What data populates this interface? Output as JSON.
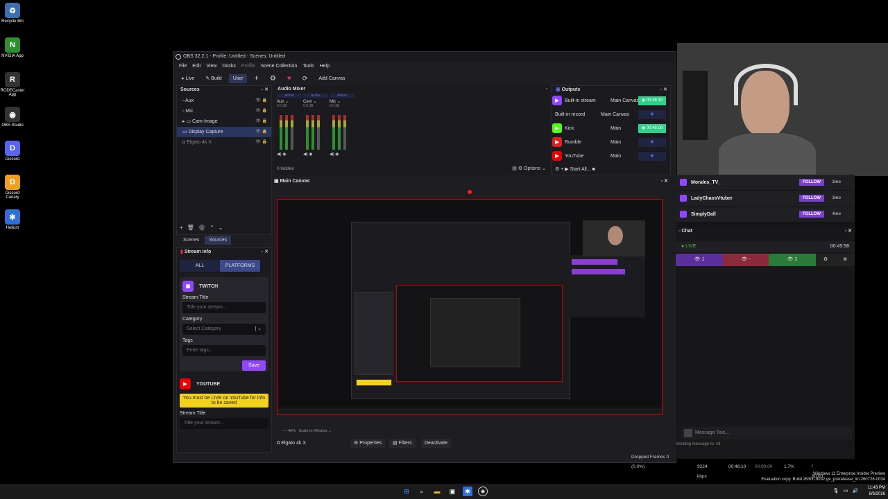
{
  "desktop": {
    "icons": [
      {
        "label": "Recycle Bin",
        "glyph": "♻",
        "color": "#3a6fb0"
      },
      {
        "label": "NVIDIA App",
        "glyph": "N",
        "color": "#2f8f2f"
      },
      {
        "label": "RODECaster App",
        "glyph": "R",
        "color": "#333"
      },
      {
        "label": "OBS Studio",
        "glyph": "◉",
        "color": "#333"
      },
      {
        "label": "Discord",
        "glyph": "D",
        "color": "#5865f2"
      },
      {
        "label": "Discord Canary",
        "glyph": "D",
        "color": "#f0a020"
      },
      {
        "label": "Helium",
        "glyph": "✱",
        "color": "#2f6fd8"
      }
    ],
    "watermark_line1": "Windows 11 Enterprise Insider Preview",
    "watermark_line2": "Evaluation copy. Build 26300.9032.ge_prerelease_im.260726-0034"
  },
  "obs": {
    "title": "OBS 32.2.1 - Profile: Untitled - Scenes: Untitled",
    "menu": [
      "File",
      "Edit",
      "View",
      "Docks",
      "Profile",
      "Scene Collection",
      "Tools",
      "Help"
    ],
    "toolbar": {
      "live": "Live",
      "build": "Build",
      "user": "User",
      "add_canvas": "Add Canvas"
    },
    "sources": {
      "title": "Sources",
      "items": [
        "Aux",
        "Mic",
        "Cam-Image",
        "Display Capture",
        "Elgato 4k X"
      ],
      "tab_scenes": "Scenes",
      "tab_sources": "Sources"
    },
    "audio_mixer": {
      "title": "Audio Mixer",
      "channels": [
        {
          "name": "Aux",
          "status": "Active",
          "db": "0.0 dB"
        },
        {
          "name": "Cam",
          "status": "Active",
          "db": "0.0 dB"
        },
        {
          "name": "Mic",
          "status": "Active",
          "db": "0.0 dB"
        }
      ],
      "hidden": "0 hidden",
      "options": "Options"
    },
    "outputs": {
      "title": "Outputs",
      "rows": [
        {
          "name": "Built-in stream",
          "canvas": "Main Canvas",
          "time": "00:46:10",
          "color": "#9146ff"
        },
        {
          "name": "Built-in record",
          "canvas": "Main Canvas",
          "time": "",
          "color": ""
        },
        {
          "name": "Kick",
          "canvas": "Main",
          "time": "00:46:09",
          "color": "#53fc18"
        },
        {
          "name": "Rumble",
          "canvas": "Main",
          "time": "",
          "color": "#d22"
        },
        {
          "name": "YouTube",
          "canvas": "Main",
          "time": "",
          "color": "#e00"
        }
      ],
      "start_all": "Start All..."
    },
    "main_canvas": {
      "title": "Main Canvas",
      "zoom": "40%",
      "scale": "Scale to Window"
    },
    "stream_info": {
      "title": "Stream Info",
      "btn_all": "ALL",
      "btn_platforms": "PLATFORMS",
      "twitch": "TWITCH",
      "stream_title_label": "Stream Title",
      "stream_title_placeholder": "Title your stream...",
      "category_label": "Category",
      "category_placeholder": "Select Category",
      "tags_label": "Tags",
      "tags_placeholder": "Enter tags...",
      "save": "Save",
      "youtube": "YOUTUBE",
      "youtube_warning": "You must be LIVE on YouTube for info to be saved",
      "youtube_stream_title": "Stream Title",
      "youtube_title_placeholder": "Title your stream..."
    },
    "source_bar": {
      "source": "Elgato 4k X",
      "properties": "Properties",
      "filters": "Filters",
      "deactivate": "Deactivate"
    },
    "status": {
      "dropped": "Dropped Frames 0 (0.0%)",
      "kbps": "9224 kbps",
      "stream_time": "00:46:10",
      "rec_time": "00:00:00",
      "cpu": "CPU: 1.7%",
      "fps": "60.00 / 60.00 FPS"
    }
  },
  "chat": {
    "followers": [
      {
        "name": "Morales_TV_",
        "follow": "FOLLOW",
        "ago": "2mo"
      },
      {
        "name": "LadyChaosVtuber",
        "follow": "FOLLOW",
        "ago": "3mo"
      },
      {
        "name": "SimplyDall",
        "follow": "FOLLOW",
        "ago": "4mo"
      }
    ],
    "title": "Chat",
    "live": "LIVE",
    "uptime": "00:45:58",
    "viewers_twitch": "1",
    "viewers_kick": "2",
    "message_placeholder": "Message Text...",
    "sending_to": "Sending message to: All"
  },
  "taskbar": {
    "time": "11:43 PM",
    "date": "8/6/2026"
  }
}
